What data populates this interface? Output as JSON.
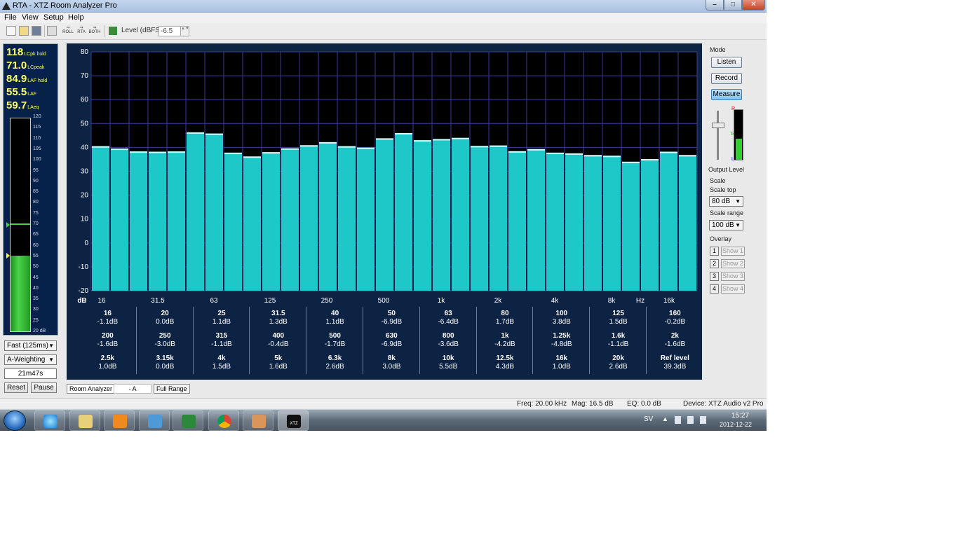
{
  "window": {
    "title": "RTA - XTZ Room Analyzer Pro",
    "min_glyph": "–",
    "max_glyph": "□",
    "close_glyph": "✕"
  },
  "menu": [
    "File",
    "View",
    "Setup",
    "Help"
  ],
  "toolbar": {
    "roll_label": "ROLL",
    "rta_label": "RTA",
    "both_label": "BOTH",
    "level_label": "Level (dBFS)",
    "level_value": "-6.5",
    "spin_glyph": "▲▼"
  },
  "levels": [
    {
      "value": "118",
      "name": "LCpk hold"
    },
    {
      "value": "71.0",
      "name": "LCpeak"
    },
    {
      "value": "84.9",
      "name": "LAF hold"
    },
    {
      "value": "55.5",
      "name": "LAF"
    },
    {
      "value": "59.7",
      "name": "LAeq"
    }
  ],
  "meter": {
    "ticks": [
      "120",
      "115",
      "110",
      "105",
      "100",
      "95",
      "90",
      "85",
      "80",
      "75",
      "70",
      "65",
      "60",
      "55",
      "50",
      "45",
      "40",
      "35",
      "30",
      "25",
      "20 dB"
    ],
    "level_db": 55.5,
    "hold_db": 70,
    "min_db": 20,
    "max_db": 120
  },
  "left_controls": {
    "speed": "Fast (125ms)",
    "weighting": "A-Weighting",
    "elapsed": "21m47s",
    "reset": "Reset",
    "pause": "Pause",
    "arrow": "▼"
  },
  "chart_data": {
    "type": "bar",
    "ylim": [
      -20,
      80
    ],
    "yticks": [
      "80",
      "70",
      "60",
      "50",
      "40",
      "30",
      "20",
      "10",
      "0",
      "-10",
      "-20"
    ],
    "grid": true,
    "values": [
      40.5,
      39.5,
      38.3,
      38.2,
      38.3,
      46.3,
      45.8,
      37.8,
      36.2,
      38.0,
      39.6,
      40.9,
      42.2,
      40.5,
      39.9,
      43.8,
      46.0,
      43.0,
      43.5,
      44.0,
      40.6,
      40.8,
      38.4,
      39.3,
      37.8,
      37.5,
      36.8,
      36.5,
      34.0,
      35.1,
      38.2,
      36.8
    ],
    "x_labels": [
      "dB",
      "16",
      "31.5",
      "63",
      "125",
      "250",
      "500",
      "1k",
      "2k",
      "4k",
      "8k",
      "Hz",
      "16k"
    ]
  },
  "band_table": [
    [
      {
        "f": "16",
        "v": "-1.1dB"
      },
      {
        "f": "200",
        "v": "-1.6dB"
      },
      {
        "f": "2.5k",
        "v": "1.0dB"
      }
    ],
    [
      {
        "f": "20",
        "v": "0.0dB"
      },
      {
        "f": "250",
        "v": "-3.0dB"
      },
      {
        "f": "3.15k",
        "v": "0.0dB"
      }
    ],
    [
      {
        "f": "25",
        "v": "1.1dB"
      },
      {
        "f": "315",
        "v": "-1.1dB"
      },
      {
        "f": "4k",
        "v": "1.5dB"
      }
    ],
    [
      {
        "f": "31.5",
        "v": "1.3dB"
      },
      {
        "f": "400",
        "v": "-0.4dB"
      },
      {
        "f": "5k",
        "v": "1.6dB"
      }
    ],
    [
      {
        "f": "40",
        "v": "1.1dB"
      },
      {
        "f": "500",
        "v": "-1.7dB"
      },
      {
        "f": "6.3k",
        "v": "2.6dB"
      }
    ],
    [
      {
        "f": "50",
        "v": "-6.9dB"
      },
      {
        "f": "630",
        "v": "-6.9dB"
      },
      {
        "f": "8k",
        "v": "3.0dB"
      }
    ],
    [
      {
        "f": "63",
        "v": "-6.4dB"
      },
      {
        "f": "800",
        "v": "-3.6dB"
      },
      {
        "f": "10k",
        "v": "5.5dB"
      }
    ],
    [
      {
        "f": "80",
        "v": "1.7dB"
      },
      {
        "f": "1k",
        "v": "-4.2dB"
      },
      {
        "f": "12.5k",
        "v": "4.3dB"
      }
    ],
    [
      {
        "f": "100",
        "v": "3.8dB"
      },
      {
        "f": "1.25k",
        "v": "-4.8dB"
      },
      {
        "f": "16k",
        "v": "1.0dB"
      }
    ],
    [
      {
        "f": "125",
        "v": "1.5dB"
      },
      {
        "f": "1.6k",
        "v": "-1.1dB"
      },
      {
        "f": "20k",
        "v": "2.6dB"
      }
    ],
    [
      {
        "f": "160",
        "v": "-0.2dB"
      },
      {
        "f": "2k",
        "v": "-1.6dB"
      },
      {
        "f": "Ref level",
        "v": "39.3dB"
      }
    ]
  ],
  "tabs": {
    "room_analyzer": "Room Analyzer",
    "weighting": "- A",
    "full_range": "Full Range"
  },
  "right_panel": {
    "mode_title": "Mode",
    "listen": "Listen",
    "record": "Record",
    "measure": "Measure",
    "output_level": "Output Level",
    "meter_top": "R",
    "meter_mid": "G",
    "meter_bottom": "L",
    "output_fraction": 0.42,
    "scale_title": "Scale",
    "scale_top_label": "Scale top",
    "scale_top_value": "80 dB",
    "scale_range_label": "Scale range",
    "scale_range_value": "100 dB",
    "overlay_title": "Overlay",
    "overlays": [
      {
        "num": "1",
        "label": "Show 1"
      },
      {
        "num": "2",
        "label": "Show 2"
      },
      {
        "num": "3",
        "label": "Show 3"
      },
      {
        "num": "4",
        "label": "Show 4"
      }
    ]
  },
  "status": {
    "freq": "Freq: 20.00 kHz",
    "mag": "Mag: 16.5 dB",
    "eq": "EQ: 0.0 dB",
    "device": "Device: XTZ Audio v2 Pro"
  },
  "taskbar": {
    "lang": "SV",
    "tray_arrow": "▲",
    "time": "15:27",
    "date": "2012-12-22",
    "xtz_label": "XTZ"
  },
  "colors": {
    "bar": "#1ec8c8",
    "bar_top": "#d8ffff",
    "plot_bg": "#000000",
    "panel_bg": "#0c2344",
    "grid": "#3c3c9c"
  }
}
